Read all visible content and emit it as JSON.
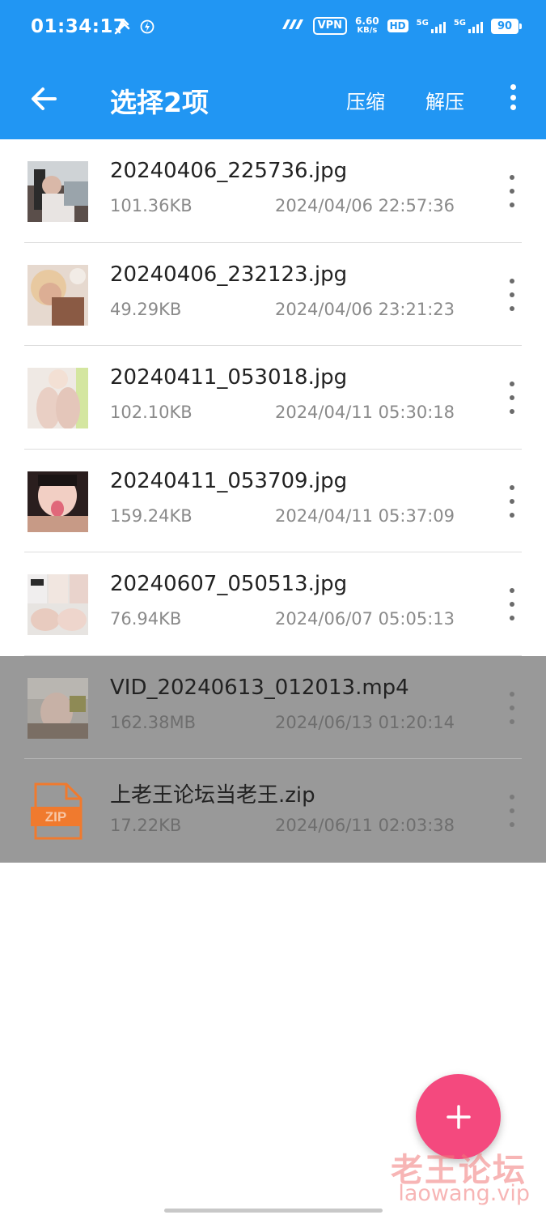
{
  "status_bar": {
    "time": "01:34:17",
    "vpn": "VPN",
    "speed_value": "6.60",
    "speed_unit": "KB/s",
    "hd": "HD",
    "network_1": "5G",
    "network_2": "5G",
    "battery": "90"
  },
  "app_bar": {
    "title": "选择2项",
    "compress_label": "压缩",
    "extract_label": "解压"
  },
  "files": [
    {
      "name": "20240406_225736.jpg",
      "size": "101.36KB",
      "date": "2024/04/06 22:57:36",
      "selected": false,
      "thumb": "photo"
    },
    {
      "name": "20240406_232123.jpg",
      "size": "49.29KB",
      "date": "2024/04/06 23:21:23",
      "selected": false,
      "thumb": "photo"
    },
    {
      "name": "20240411_053018.jpg",
      "size": "102.10KB",
      "date": "2024/04/11 05:30:18",
      "selected": false,
      "thumb": "photo"
    },
    {
      "name": "20240411_053709.jpg",
      "size": "159.24KB",
      "date": "2024/04/11 05:37:09",
      "selected": false,
      "thumb": "photo"
    },
    {
      "name": "20240607_050513.jpg",
      "size": "76.94KB",
      "date": "2024/06/07 05:05:13",
      "selected": false,
      "thumb": "photo"
    },
    {
      "name": "VID_20240613_012013.mp4",
      "size": "162.38MB",
      "date": "2024/06/13 01:20:14",
      "selected": true,
      "thumb": "video"
    },
    {
      "name": "上老王论坛当老王.zip",
      "size": "17.22KB",
      "date": "2024/06/11 02:03:38",
      "selected": true,
      "thumb": "zip",
      "zip_label": "ZIP"
    }
  ],
  "fab_icon": "plus-icon",
  "watermark": {
    "title": "老王论坛",
    "url": "laowang.vip"
  },
  "colors": {
    "primary": "#2196F3",
    "fab": "#f4497e",
    "selected_row": "#999999",
    "zip_orange": "#f07a2e"
  }
}
